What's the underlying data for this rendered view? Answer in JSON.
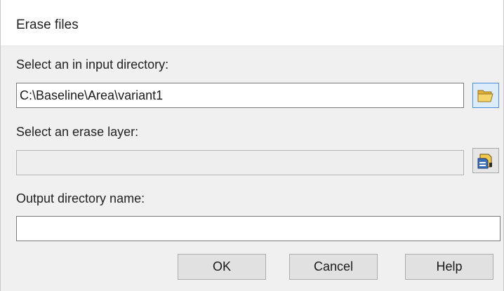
{
  "window": {
    "title": "Erase files"
  },
  "input_directory": {
    "label": "Select an in input directory:",
    "value": "C:\\Baseline\\Area\\variant1",
    "browse_icon": "folder-open-icon"
  },
  "erase_layer": {
    "label": "Select an erase layer:",
    "value": "",
    "state": "disabled",
    "browse_icon": "layers-icon"
  },
  "output_directory": {
    "label": "Output directory name:",
    "value": ""
  },
  "buttons": {
    "ok_label": "OK",
    "cancel_label": "Cancel",
    "help_label": "Help"
  },
  "colors": {
    "dialog_background": "#f0f0f0",
    "title_background": "#ffffff",
    "folder_button_accent": "#4a8ed8",
    "folder_icon_fill": "#f5d46b"
  }
}
